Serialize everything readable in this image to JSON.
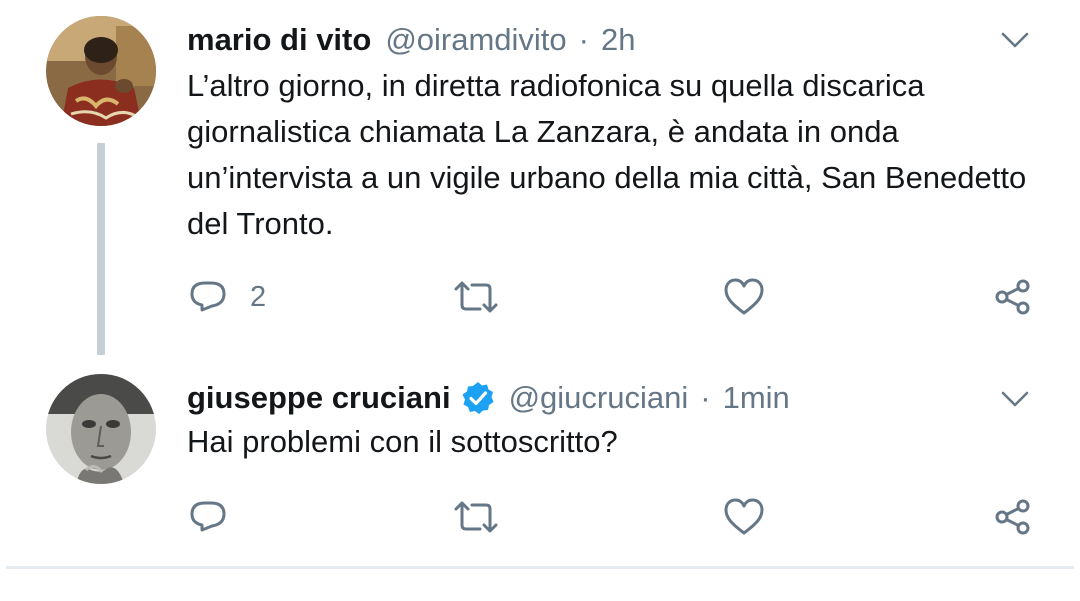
{
  "tweets": [
    {
      "author_name": "mario di vito",
      "handle": "@oiramdivito",
      "separator": "·",
      "time": "2h",
      "verified": false,
      "text": "L’altro giorno, in diretta radiofonica su quella discarica giornalistica chiamata La Zanzara, è andata in onda un’intervista a un vigile urbano della mia città, San Benedetto del Tronto.",
      "reply_count": "2",
      "retweet_count": "",
      "like_count": ""
    },
    {
      "author_name": "giuseppe cruciani",
      "handle": "@giucruciani",
      "separator": "·",
      "time": "1min",
      "verified": true,
      "text": "Hai problemi con il sottoscritto?",
      "reply_count": "",
      "retweet_count": "",
      "like_count": ""
    }
  ],
  "icons": {
    "reply": "reply-icon",
    "retweet": "retweet-icon",
    "like": "heart-icon",
    "share": "share-icon",
    "menu": "chevron-down-icon",
    "verified": "verified-badge-icon"
  },
  "colors": {
    "text": "#14171a",
    "secondary": "#657786",
    "verified": "#1da1f2",
    "thread_line": "#c4cfd6",
    "divider": "#e6ecf0"
  }
}
